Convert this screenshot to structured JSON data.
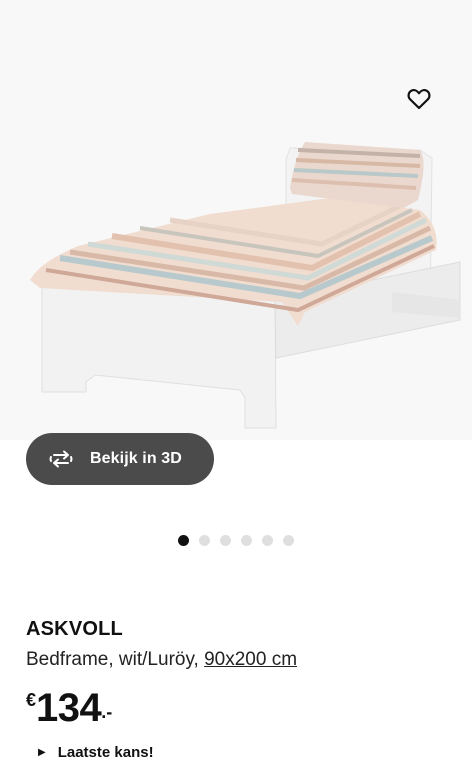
{
  "product": {
    "name": "ASKVOLL",
    "description": "Bedframe, wit/Luröy,",
    "size": "90x200 cm",
    "price": {
      "currency": "€",
      "amount": "134",
      "decimals": ".-"
    },
    "last_chance": "Laatste kans!"
  },
  "view3d": {
    "label": "Bekijk in 3D",
    "icon": "rotate-3d-icon"
  },
  "favorite": {
    "icon": "heart-icon"
  },
  "carousel": {
    "total": 6,
    "active_index": 0
  },
  "colors": {
    "button_bg": "#4b4b4b",
    "dot_active": "#111111",
    "dot_inactive": "#dfdfdf"
  }
}
